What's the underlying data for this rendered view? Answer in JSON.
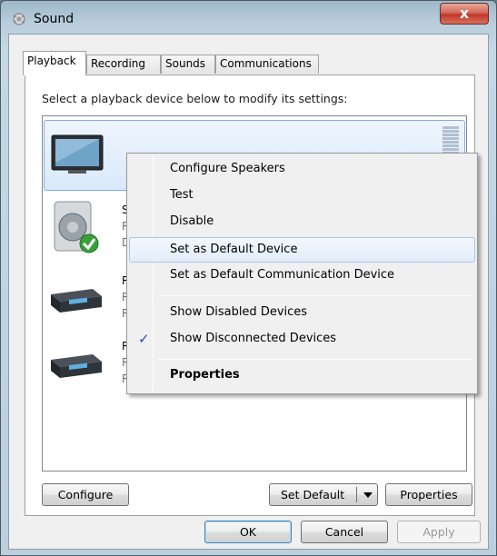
{
  "window": {
    "title": "Sound",
    "close_label": "x"
  },
  "tabs": [
    {
      "label": "Playback",
      "active": true
    },
    {
      "label": "Recording",
      "active": false
    },
    {
      "label": "Sounds",
      "active": false
    },
    {
      "label": "Communications",
      "active": false
    }
  ],
  "instruction": "Select a playback device below to modify its settings:",
  "devices": [
    {
      "icon": "monitor-icon",
      "line1": "",
      "line2": "",
      "line3": "",
      "selected": true
    },
    {
      "icon": "speaker-icon",
      "line1": "S",
      "line2": "R",
      "line3": "D",
      "default": true
    },
    {
      "icon": "receiver-icon",
      "line1": "R",
      "line2": "R",
      "line3": "R"
    },
    {
      "icon": "receiver-icon",
      "line1": "R",
      "line2": "R",
      "line3": "R"
    }
  ],
  "buttons": {
    "configure": "Configure",
    "set_default": "Set Default",
    "properties": "Properties",
    "ok": "OK",
    "cancel": "Cancel",
    "apply": "Apply"
  },
  "context_menu": {
    "items": [
      {
        "label": "Configure Speakers"
      },
      {
        "label": "Test"
      },
      {
        "label": "Disable"
      },
      {
        "label": "Set as Default Device",
        "hover": true
      },
      {
        "label": "Set as Default Communication Device"
      },
      {
        "label": "Show Disabled Devices"
      },
      {
        "label": "Show Disconnected Devices",
        "checked": true,
        "check_mark": "✓"
      },
      {
        "label": "Properties",
        "bold": true
      }
    ]
  },
  "colors": {
    "accent": "#3c7fb1",
    "selection": "#d9e9fb",
    "check": "#2a4fa8",
    "default_badge": "#3aa03a"
  }
}
